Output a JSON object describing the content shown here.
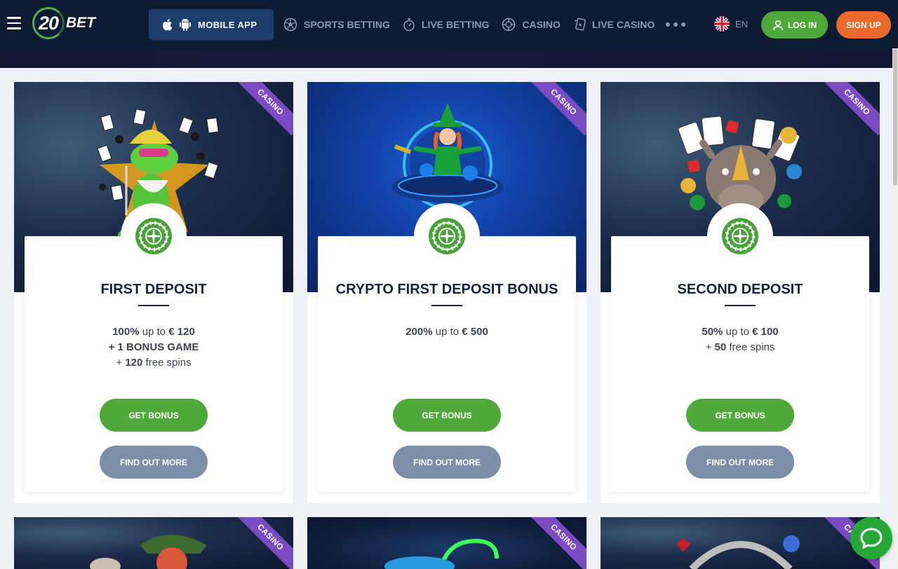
{
  "header": {
    "logo_number": "20",
    "logo_text": "BET",
    "mobile_app_label": "MOBILE APP",
    "nav": [
      {
        "label": "SPORTS BETTING",
        "icon": "soccer-ball-icon"
      },
      {
        "label": "LIVE BETTING",
        "icon": "stopwatch-icon"
      },
      {
        "label": "CASINO",
        "icon": "roulette-chip-icon"
      },
      {
        "label": "LIVE CASINO",
        "icon": "playing-cards-icon"
      }
    ],
    "language": "EN",
    "login_label": "LOG IN",
    "signup_label": "SIGN UP"
  },
  "colors": {
    "header_bg": "#0d1b33",
    "accent_green": "#4fa83a",
    "signup_orange": "#ea6a2c",
    "ribbon_purple": "#7b4bc4",
    "more_button": "#7d8fa8"
  },
  "cards": [
    {
      "ribbon": "CASINO",
      "title": "FIRST DEPOSIT",
      "lines": [
        [
          {
            "t": "100%",
            "b": true
          },
          {
            "t": " up to ",
            "b": false
          },
          {
            "t": "€ 120",
            "b": true
          }
        ],
        [
          {
            "t": "+ 1 BONUS GAME",
            "b": true
          }
        ],
        [
          {
            "t": "+ ",
            "b": false
          },
          {
            "t": "120",
            "b": true
          },
          {
            "t": " free spins",
            "b": false
          }
        ]
      ],
      "get_bonus": "GET BONUS",
      "find_out_more": "FIND OUT MORE"
    },
    {
      "ribbon": "CASINO",
      "title": "CRYPTO FIRST DEPOSIT BONUS",
      "lines": [
        [
          {
            "t": "200%",
            "b": true
          },
          {
            "t": " up to ",
            "b": false
          },
          {
            "t": "€ 500",
            "b": true
          }
        ]
      ],
      "get_bonus": "GET BONUS",
      "find_out_more": "FIND OUT MORE"
    },
    {
      "ribbon": "CASINO",
      "title": "SECOND DEPOSIT",
      "lines": [
        [
          {
            "t": "50%",
            "b": true
          },
          {
            "t": " up to ",
            "b": false
          },
          {
            "t": "€ 100",
            "b": true
          }
        ],
        [
          {
            "t": "+ ",
            "b": false
          },
          {
            "t": "50",
            "b": true
          },
          {
            "t": " free spins",
            "b": false
          }
        ]
      ],
      "get_bonus": "GET BONUS",
      "find_out_more": "FIND OUT MORE"
    }
  ],
  "row2_ribbons": [
    "CASINO",
    "CASINO",
    "CASINO"
  ]
}
